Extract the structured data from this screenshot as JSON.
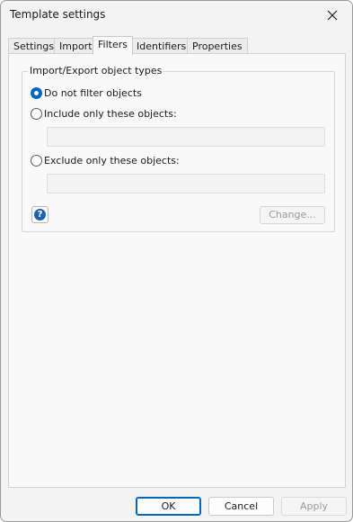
{
  "window": {
    "title": "Template settings",
    "close_icon": "close-icon"
  },
  "tabs": [
    {
      "label": "Settings",
      "active": false
    },
    {
      "label": "Import",
      "active": false
    },
    {
      "label": "Filters",
      "active": true
    },
    {
      "label": "Identifiers",
      "active": false
    },
    {
      "label": "Properties",
      "active": false
    }
  ],
  "filters": {
    "group_title": "Import/Export object types",
    "options": [
      {
        "label": "Do not filter objects",
        "checked": true
      },
      {
        "label": "Include only these objects:",
        "checked": false
      },
      {
        "label": "Exclude only these objects:",
        "checked": false
      }
    ],
    "include_value": "",
    "exclude_value": "",
    "help_icon": "help-icon",
    "help_glyph": "?",
    "change_label": "Change..."
  },
  "footer": {
    "ok_label": "OK",
    "cancel_label": "Cancel",
    "apply_label": "Apply"
  },
  "colors": {
    "accent": "#0067c0",
    "help_icon": "#1f5fb3",
    "disabled_text": "#9a9a9a"
  }
}
